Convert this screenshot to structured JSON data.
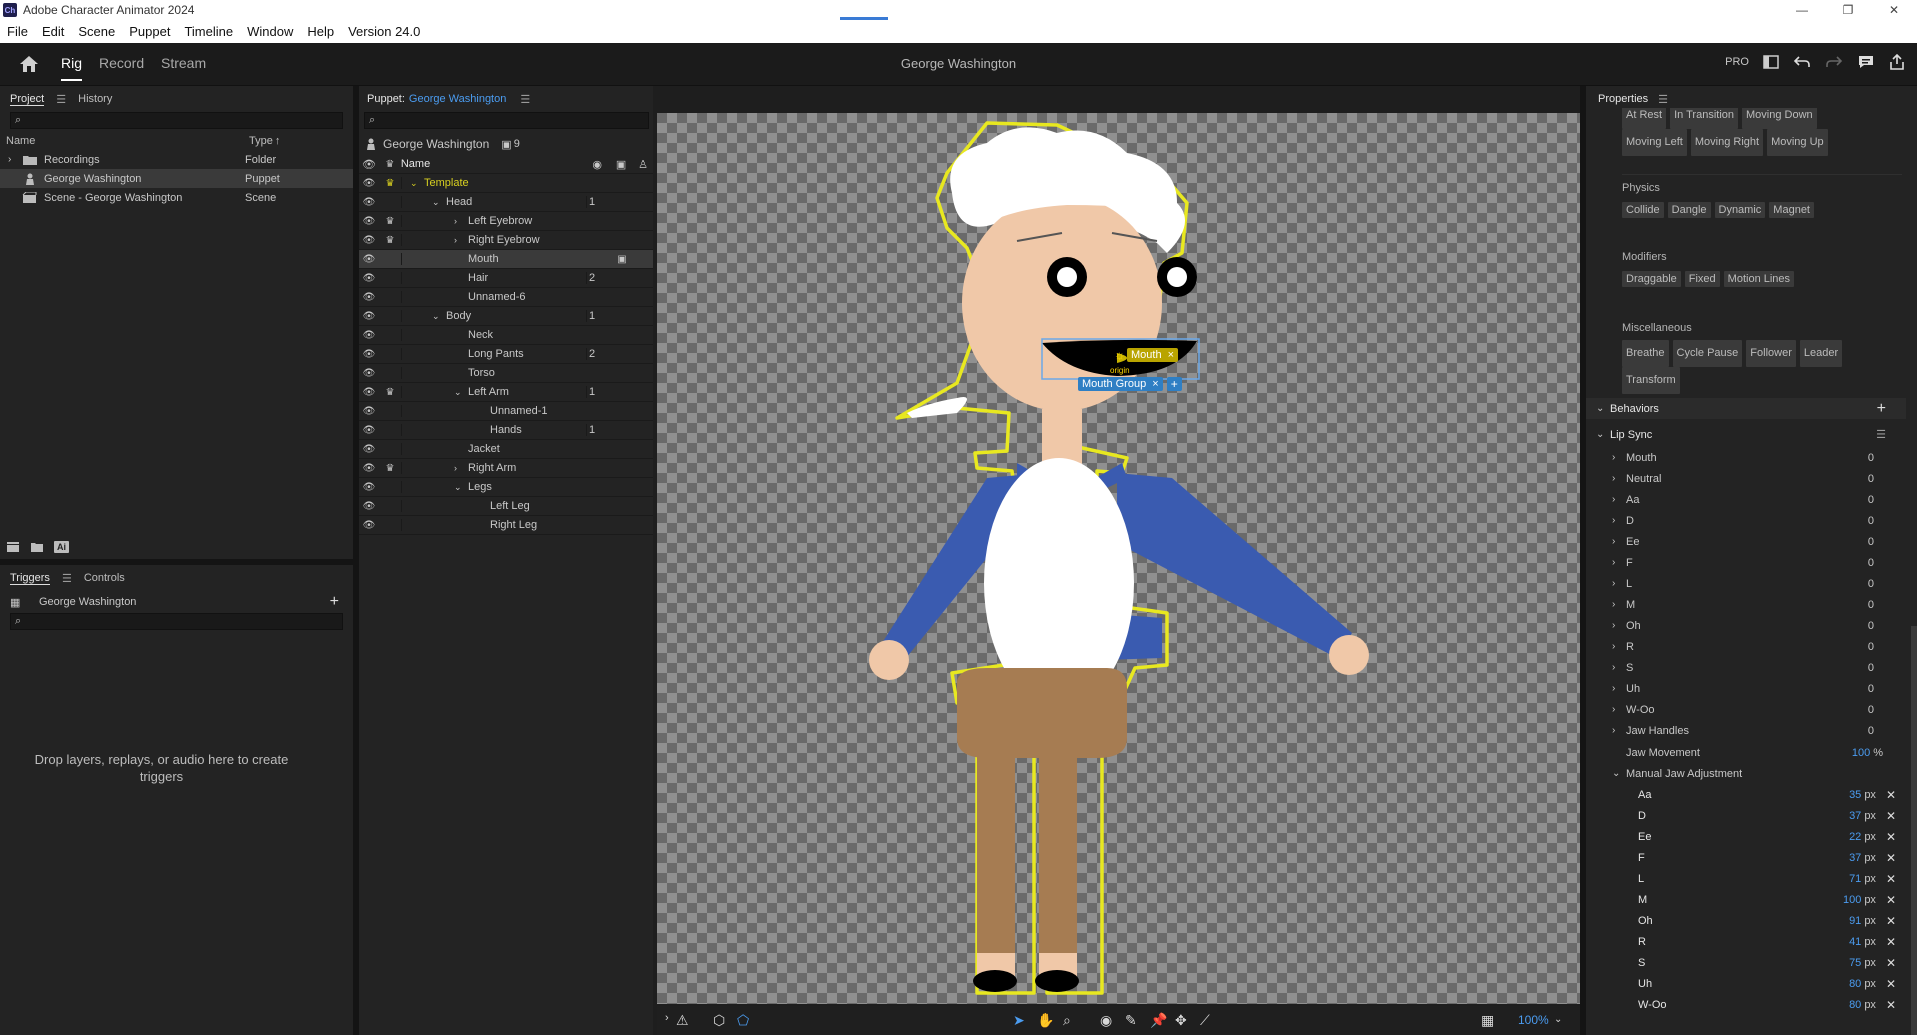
{
  "app": {
    "title": "Adobe Character Animator 2024",
    "icon_label": "Ch",
    "window_controls": [
      "—",
      "❐",
      "✕"
    ]
  },
  "menu": [
    "File",
    "Edit",
    "Scene",
    "Puppet",
    "Timeline",
    "Window",
    "Help",
    "Version 24.0"
  ],
  "appbar": {
    "modes": [
      "Rig",
      "Record",
      "Stream"
    ],
    "active_mode": "Rig",
    "center_title": "George Washington",
    "pro_label": "PRO"
  },
  "project": {
    "tabs": [
      "Project",
      "History"
    ],
    "columns": {
      "name": "Name",
      "type": "Type"
    },
    "items": [
      {
        "name": "Recordings",
        "type": "Folder"
      },
      {
        "name": "George Washington",
        "type": "Puppet"
      },
      {
        "name": "Scene - George Washington",
        "type": "Scene"
      }
    ],
    "footer_ai_label": "Ai"
  },
  "triggers": {
    "tabs": [
      "Triggers",
      "Controls"
    ],
    "puppet": "George Washington",
    "empty_message": "Drop layers, replays, or audio here to create triggers"
  },
  "puppet": {
    "header_prefix": "Puppet:",
    "header_name": "George Washington",
    "title": "George Washington",
    "count": "9",
    "name_col": "Name",
    "layers": [
      {
        "label": "Template",
        "indent": 0,
        "twist": "open",
        "crown": true,
        "count": ""
      },
      {
        "label": "Head",
        "indent": 1,
        "twist": "open",
        "crown": false,
        "count": "1"
      },
      {
        "label": "Left Eyebrow",
        "indent": 2,
        "twist": "closed",
        "crown": true,
        "count": ""
      },
      {
        "label": "Right Eyebrow",
        "indent": 2,
        "twist": "closed",
        "crown": true,
        "count": ""
      },
      {
        "label": "Mouth",
        "indent": 2,
        "twist": "",
        "crown": false,
        "count": "",
        "selected": true
      },
      {
        "label": "Hair",
        "indent": 2,
        "twist": "",
        "crown": false,
        "count": "2"
      },
      {
        "label": "Unnamed-6",
        "indent": 2,
        "twist": "",
        "crown": false,
        "count": ""
      },
      {
        "label": "Body",
        "indent": 1,
        "twist": "open",
        "crown": false,
        "count": "1"
      },
      {
        "label": "Neck",
        "indent": 2,
        "twist": "",
        "crown": false,
        "count": ""
      },
      {
        "label": "Long Pants",
        "indent": 2,
        "twist": "",
        "crown": false,
        "count": "2"
      },
      {
        "label": "Torso",
        "indent": 2,
        "twist": "",
        "crown": false,
        "count": ""
      },
      {
        "label": "Left Arm",
        "indent": 2,
        "twist": "open",
        "crown": true,
        "count": "1"
      },
      {
        "label": "Unnamed-1",
        "indent": 3,
        "twist": "",
        "crown": false,
        "count": ""
      },
      {
        "label": "Hands",
        "indent": 3,
        "twist": "",
        "crown": false,
        "count": "1"
      },
      {
        "label": "Jacket",
        "indent": 2,
        "twist": "",
        "crown": false,
        "count": ""
      },
      {
        "label": "Right Arm",
        "indent": 2,
        "twist": "closed",
        "crown": true,
        "count": ""
      },
      {
        "label": "Legs",
        "indent": 2,
        "twist": "open",
        "crown": false,
        "count": ""
      },
      {
        "label": "Left Leg",
        "indent": 3,
        "twist": "",
        "crown": false,
        "count": ""
      },
      {
        "label": "Right Leg",
        "indent": 3,
        "twist": "",
        "crown": false,
        "count": ""
      }
    ]
  },
  "canvas": {
    "mouth_tag": "Mouth",
    "mouth_group_tag": "Mouth Group",
    "origin_label": "origin",
    "zoom": "100%"
  },
  "properties": {
    "title": "Properties",
    "top_tags": [
      [
        "At Rest",
        "In Transition",
        "Moving Down"
      ],
      [
        "Moving Left",
        "Moving Right",
        "Moving Up"
      ]
    ],
    "sections": [
      {
        "label": "Physics",
        "tags": [
          "Collide",
          "Dangle",
          "Dynamic",
          "Magnet"
        ]
      },
      {
        "label": "Modifiers",
        "tags": [
          "Draggable",
          "Fixed",
          "Motion Lines"
        ]
      },
      {
        "label": "Miscellaneous",
        "tags": [
          "Breathe",
          "Cycle Pause",
          "Follower",
          "Leader",
          "Transform"
        ]
      }
    ],
    "behaviors_label": "Behaviors",
    "lipsync_label": "Lip Sync",
    "visemes": [
      {
        "name": "Mouth",
        "value": "0"
      },
      {
        "name": "Neutral",
        "value": "0"
      },
      {
        "name": "Aa",
        "value": "0"
      },
      {
        "name": "D",
        "value": "0"
      },
      {
        "name": "Ee",
        "value": "0"
      },
      {
        "name": "F",
        "value": "0"
      },
      {
        "name": "L",
        "value": "0"
      },
      {
        "name": "M",
        "value": "0"
      },
      {
        "name": "Oh",
        "value": "0"
      },
      {
        "name": "R",
        "value": "0"
      },
      {
        "name": "S",
        "value": "0"
      },
      {
        "name": "Uh",
        "value": "0"
      },
      {
        "name": "W-Oo",
        "value": "0"
      },
      {
        "name": "Jaw Handles",
        "value": "0"
      }
    ],
    "jaw_movement": {
      "label": "Jaw Movement",
      "value": "100",
      "unit": "%"
    },
    "manual_jaw_label": "Manual Jaw Adjustment",
    "manual_jaw": [
      {
        "name": "Aa",
        "value": "35",
        "unit": "px"
      },
      {
        "name": "D",
        "value": "37",
        "unit": "px"
      },
      {
        "name": "Ee",
        "value": "22",
        "unit": "px"
      },
      {
        "name": "F",
        "value": "37",
        "unit": "px"
      },
      {
        "name": "L",
        "value": "71",
        "unit": "px"
      },
      {
        "name": "M",
        "value": "100",
        "unit": "px"
      },
      {
        "name": "Oh",
        "value": "91",
        "unit": "px"
      },
      {
        "name": "R",
        "value": "41",
        "unit": "px"
      },
      {
        "name": "S",
        "value": "75",
        "unit": "px"
      },
      {
        "name": "Uh",
        "value": "80",
        "unit": "px"
      },
      {
        "name": "W-Oo",
        "value": "80",
        "unit": "px"
      }
    ]
  }
}
